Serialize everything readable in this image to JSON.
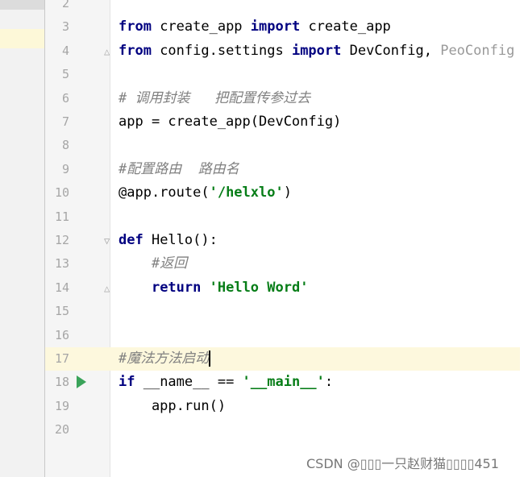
{
  "lines": [
    {
      "n": "2",
      "parts": []
    },
    {
      "n": "3",
      "parts": [
        {
          "t": "from",
          "c": "kw"
        },
        {
          "t": " create_app ",
          "c": ""
        },
        {
          "t": "import",
          "c": "kw"
        },
        {
          "t": " create_app",
          "c": ""
        }
      ]
    },
    {
      "n": "4",
      "parts": [
        {
          "t": "from",
          "c": "kw"
        },
        {
          "t": " config.settings ",
          "c": ""
        },
        {
          "t": "import",
          "c": "kw"
        },
        {
          "t": " DevConfig, ",
          "c": ""
        },
        {
          "t": "PeoConfig",
          "c": "gray"
        }
      ]
    },
    {
      "n": "5",
      "parts": []
    },
    {
      "n": "6",
      "parts": [
        {
          "t": "# 调用封装   把配置传参过去",
          "c": "cm"
        }
      ]
    },
    {
      "n": "7",
      "parts": [
        {
          "t": "app = create_app(DevConfig)",
          "c": ""
        }
      ]
    },
    {
      "n": "8",
      "parts": []
    },
    {
      "n": "9",
      "parts": [
        {
          "t": "#配置路由  路由名",
          "c": "cm"
        }
      ]
    },
    {
      "n": "10",
      "parts": [
        {
          "t": "@app.route(",
          "c": ""
        },
        {
          "t": "'/helxlo'",
          "c": "str"
        },
        {
          "t": ")",
          "c": ""
        }
      ]
    },
    {
      "n": "11",
      "parts": []
    },
    {
      "n": "12",
      "parts": [
        {
          "t": "def",
          "c": "kw"
        },
        {
          "t": " Hello():",
          "c": ""
        }
      ]
    },
    {
      "n": "13",
      "parts": [
        {
          "t": "    #返回",
          "c": "cm"
        }
      ]
    },
    {
      "n": "14",
      "parts": [
        {
          "t": "    ",
          "c": ""
        },
        {
          "t": "return",
          "c": "kw"
        },
        {
          "t": " ",
          "c": ""
        },
        {
          "t": "'Hello Word'",
          "c": "str"
        }
      ]
    },
    {
      "n": "15",
      "parts": []
    },
    {
      "n": "16",
      "parts": []
    },
    {
      "n": "17",
      "parts": [
        {
          "t": "#魔法方法启动",
          "c": "cm"
        }
      ]
    },
    {
      "n": "18",
      "parts": [
        {
          "t": "if",
          "c": "kw"
        },
        {
          "t": " __name__ == ",
          "c": ""
        },
        {
          "t": "'__main__'",
          "c": "str"
        },
        {
          "t": ":",
          "c": ""
        }
      ]
    },
    {
      "n": "19",
      "parts": [
        {
          "t": "    app.run()",
          "c": ""
        }
      ]
    },
    {
      "n": "20",
      "parts": []
    }
  ],
  "watermark": "CSDN @\u0000\u0000\u0000一只赵财猫\u0000\u0000\u0000\u0000451",
  "colors": {
    "keyword": "#000080",
    "comment": "#808080",
    "string": "#067d17",
    "caret_line": "#fdf8dd",
    "run_icon": "#3aa35a"
  }
}
